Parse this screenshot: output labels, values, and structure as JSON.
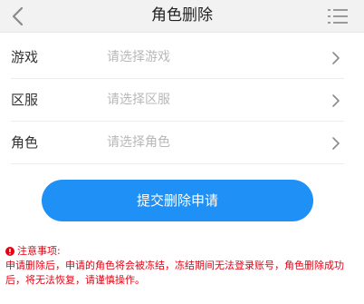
{
  "header": {
    "title": "角色删除",
    "back_icon": "chevron-left-icon",
    "menu_icon": "list-menu-icon"
  },
  "form": {
    "rows": [
      {
        "label": "游戏",
        "placeholder": "请选择游戏"
      },
      {
        "label": "区服",
        "placeholder": "请选择区服"
      },
      {
        "label": "角色",
        "placeholder": "请选择角色"
      }
    ]
  },
  "submit": {
    "label": "提交删除申请"
  },
  "notice": {
    "title": "注意事项:",
    "text": "申请删除后，申请的角色将会被冻结，冻结期间无法登录账号，角色删除成功后，将无法恢复，请谨慎操作。"
  },
  "colors": {
    "accent": "#1f90f5",
    "warning": "#e60012",
    "header_bg": "#f2f2f2",
    "placeholder": "#b8b8b8"
  }
}
